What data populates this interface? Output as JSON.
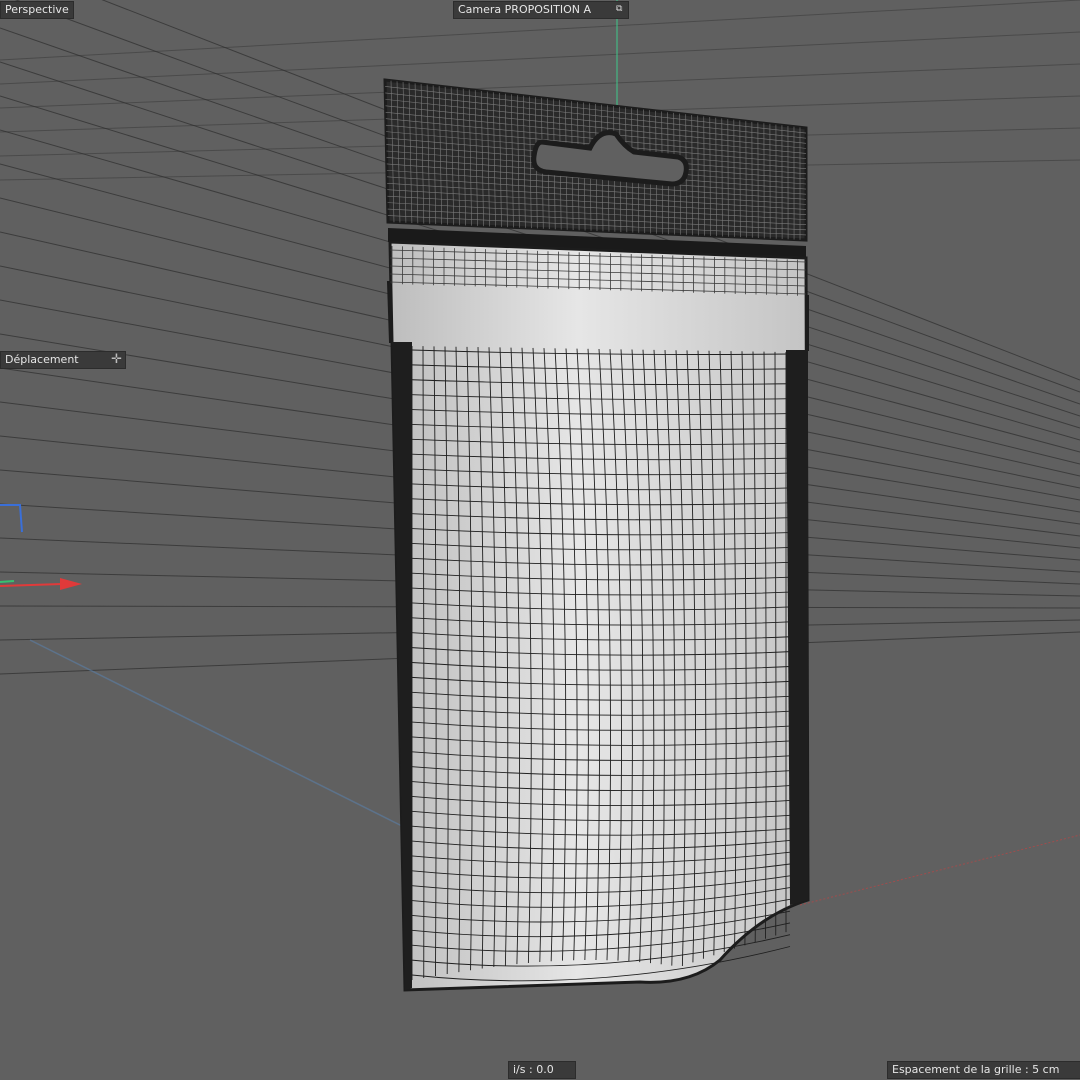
{
  "viewport": {
    "view_name": "Perspective",
    "camera_name": "Camera PROPOSITION A",
    "active_tool": "Déplacement",
    "fps": "i/s : 0.0",
    "grid_spacing": "Espacement de la grille : 5 cm"
  },
  "icons": {
    "camera": "camera-icon",
    "move": "move-icon",
    "axis_gizmo": "axis-gizmo-icon"
  },
  "colors": {
    "background": "#606060",
    "grid": "#303030",
    "mesh_wire": "#1c1c1c",
    "mesh_fill": "#d4d4d4",
    "axis_x": "#e03a3a",
    "axis_y": "#38c070",
    "axis_z": "#3a6fd8",
    "hud_bg": "#3a3a3a",
    "hud_text": "#e6e6e6"
  }
}
